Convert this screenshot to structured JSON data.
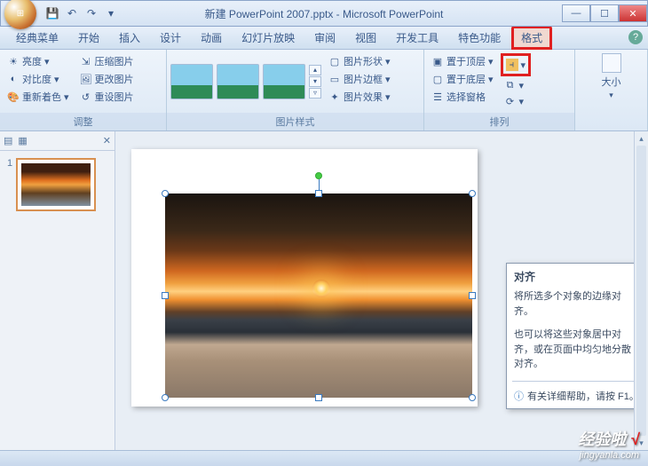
{
  "title": "新建 PowerPoint 2007.pptx - Microsoft PowerPoint",
  "qat": {
    "save": "💾",
    "undo": "↶",
    "redo": "↷",
    "more": "▾"
  },
  "menu": {
    "tabs": [
      "经典菜单",
      "开始",
      "插入",
      "设计",
      "动画",
      "幻灯片放映",
      "审阅",
      "视图",
      "开发工具",
      "特色功能",
      "格式"
    ]
  },
  "ribbon": {
    "adjust": {
      "label": "调整",
      "brightness": "亮度",
      "contrast": "对比度",
      "recolor": "重新着色",
      "compress": "压缩图片",
      "change": "更改图片",
      "reset": "重设图片"
    },
    "styles": {
      "label": "图片样式",
      "shape": "图片形状",
      "border": "图片边框",
      "effects": "图片效果"
    },
    "arrange": {
      "label": "排列",
      "front": "置于顶层",
      "back": "置于底层",
      "pane": "选择窗格"
    },
    "size": {
      "label": "大小"
    }
  },
  "thumb": {
    "num": "1"
  },
  "tooltip": {
    "title": "对齐",
    "p1": "将所选多个对象的边缘对齐。",
    "p2": "也可以将这些对象居中对齐，或在页面中均匀地分散对齐。",
    "help": "有关详细帮助，请按 F1。"
  },
  "watermark": {
    "line1": "经验啦",
    "check": "√",
    "line2": "jingyanla.com"
  },
  "win": {
    "min": "—",
    "max": "☐",
    "close": "✕"
  },
  "help": "?"
}
